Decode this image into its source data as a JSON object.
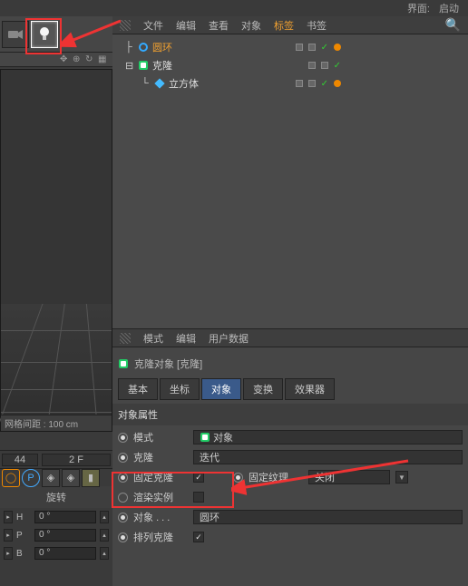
{
  "topbar": {
    "label1": "界面:",
    "label2": "启动"
  },
  "obj_menu": {
    "file": "文件",
    "edit": "编辑",
    "view": "查看",
    "object": "对象",
    "tags": "标签",
    "bookmark": "书签"
  },
  "tree": {
    "items": [
      {
        "name": "圆环",
        "selected": true
      },
      {
        "name": "克隆",
        "selected": false
      },
      {
        "name": "立方体",
        "selected": false
      }
    ]
  },
  "viewport": {
    "status": "网格间距 : 100 cm"
  },
  "attr_menu": {
    "mode": "模式",
    "edit": "编辑",
    "userdata": "用户数据"
  },
  "attr": {
    "title": "克隆对象 [克隆]",
    "tabs": {
      "basic": "基本",
      "coord": "坐标",
      "object": "对象",
      "transform": "变换",
      "effector": "效果器"
    },
    "section": "对象属性",
    "rows": {
      "mode": {
        "label": "模式",
        "value": "对象"
      },
      "clone": {
        "label": "克隆",
        "value": "迭代"
      },
      "fixclone": {
        "label": "固定克隆"
      },
      "fixtex": {
        "label": "固定纹理",
        "value": "关闭"
      },
      "render": {
        "label": "渲染实例"
      },
      "object": {
        "label": "对象",
        "dots": ". . .",
        "value": "圆环"
      },
      "arrange": {
        "label": "排列克隆"
      }
    }
  },
  "timeline": {
    "frame": "44",
    "frame2": "2 F",
    "rotation": "旋转",
    "h": {
      "lbl": "H",
      "val": "0 °"
    },
    "p": {
      "lbl": "P",
      "val": "0 °"
    },
    "b": {
      "lbl": "B",
      "val": "0 °"
    }
  }
}
